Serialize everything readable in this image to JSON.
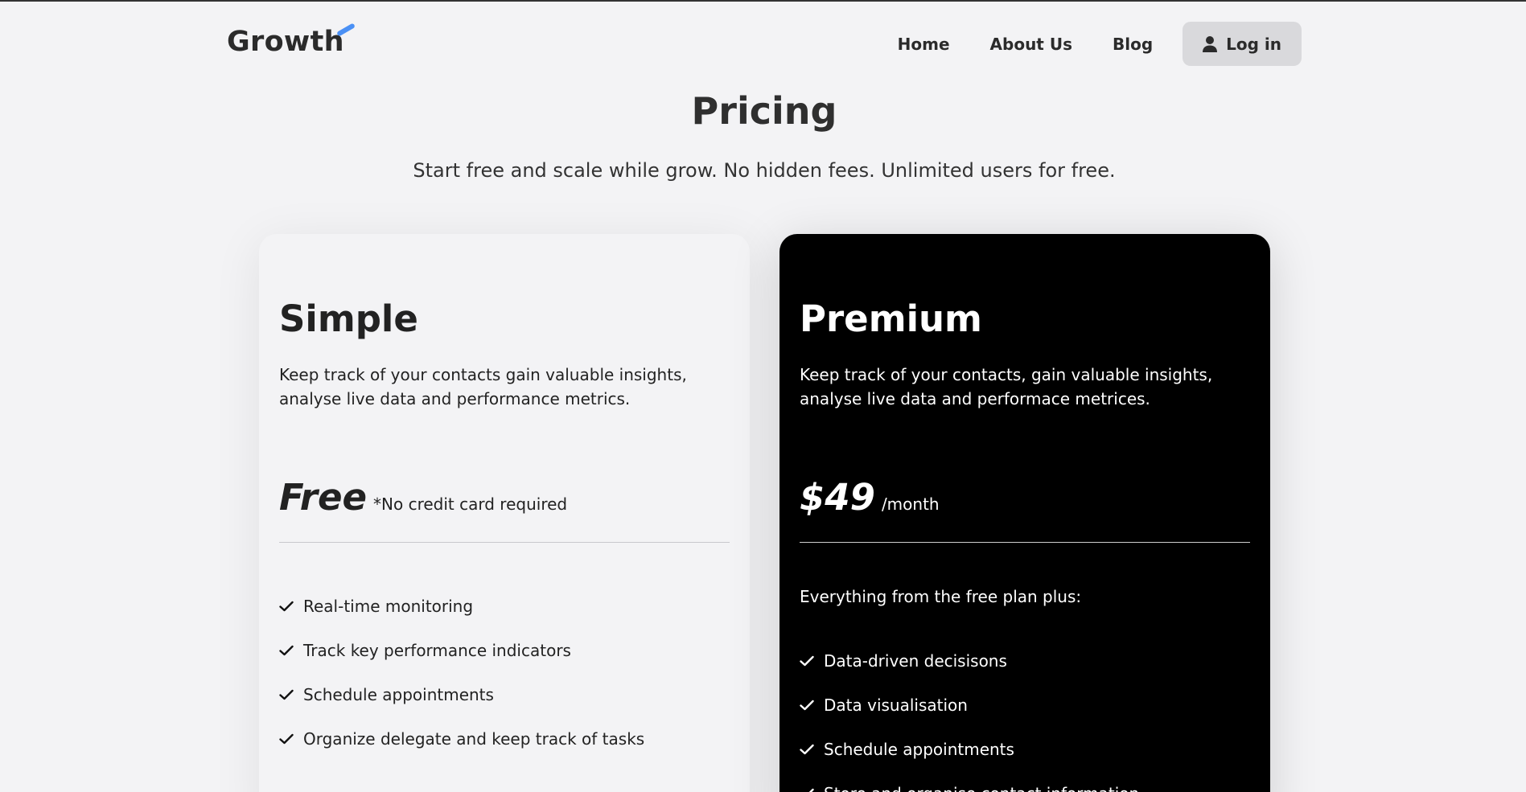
{
  "header": {
    "logo_text": "Growth",
    "nav": [
      {
        "label": "Home"
      },
      {
        "label": "About Us"
      },
      {
        "label": "Blog"
      }
    ],
    "login_label": "Log in",
    "login_icon": "user-icon",
    "accent_color": "#4a90f5"
  },
  "hero": {
    "title": "Pricing",
    "subtitle": "Start free and scale while grow. No hidden fees. Unlimited users for free."
  },
  "plans": [
    {
      "name": "Simple",
      "description": "Keep track of your contacts gain valuable insights, analyse live data and performance metrics.",
      "price": "Free",
      "price_note": "*No credit card required",
      "features": [
        "Real-time monitoring",
        "Track key performance indicators",
        "Schedule appointments",
        "Organize delegate and keep track of tasks"
      ]
    },
    {
      "name": "Premium",
      "description": "Keep track of your contacts, gain valuable insights, analyse live data and performace metrices.",
      "price": "$49",
      "price_note": "/month",
      "intro": "Everything from the free plan plus:",
      "features": [
        "Data-driven decisisons",
        "Data visualisation",
        "Schedule appointments",
        "Store and organise contact information"
      ]
    }
  ]
}
